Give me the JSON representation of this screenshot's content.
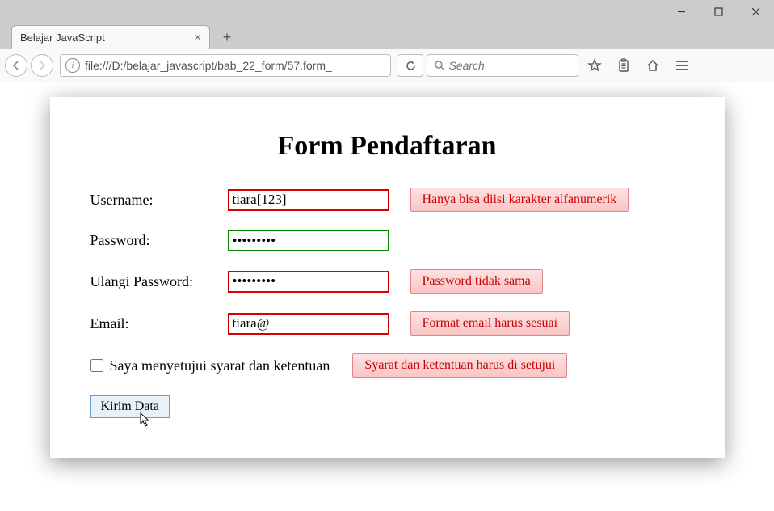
{
  "window": {
    "tab_title": "Belajar JavaScript",
    "url": "file:///D:/belajar_javascript/bab_22_form/57.form_",
    "search_placeholder": "Search"
  },
  "form": {
    "title": "Form Pendaftaran",
    "labels": {
      "username": "Username:",
      "password": "Password:",
      "repeat_password": "Ulangi Password:",
      "email": "Email:",
      "agree": "Saya menyetujui syarat dan ketentuan"
    },
    "values": {
      "username": "tiara[123]",
      "password": "•••••••••",
      "repeat_password": "•••••••••",
      "email": "tiara@"
    },
    "errors": {
      "username": "Hanya bisa diisi karakter alfanumerik",
      "repeat_password": "Password tidak sama",
      "email": "Format email harus sesuai",
      "agree": "Syarat dan ketentuan harus di setujui"
    },
    "submit_label": "Kirim Data"
  }
}
